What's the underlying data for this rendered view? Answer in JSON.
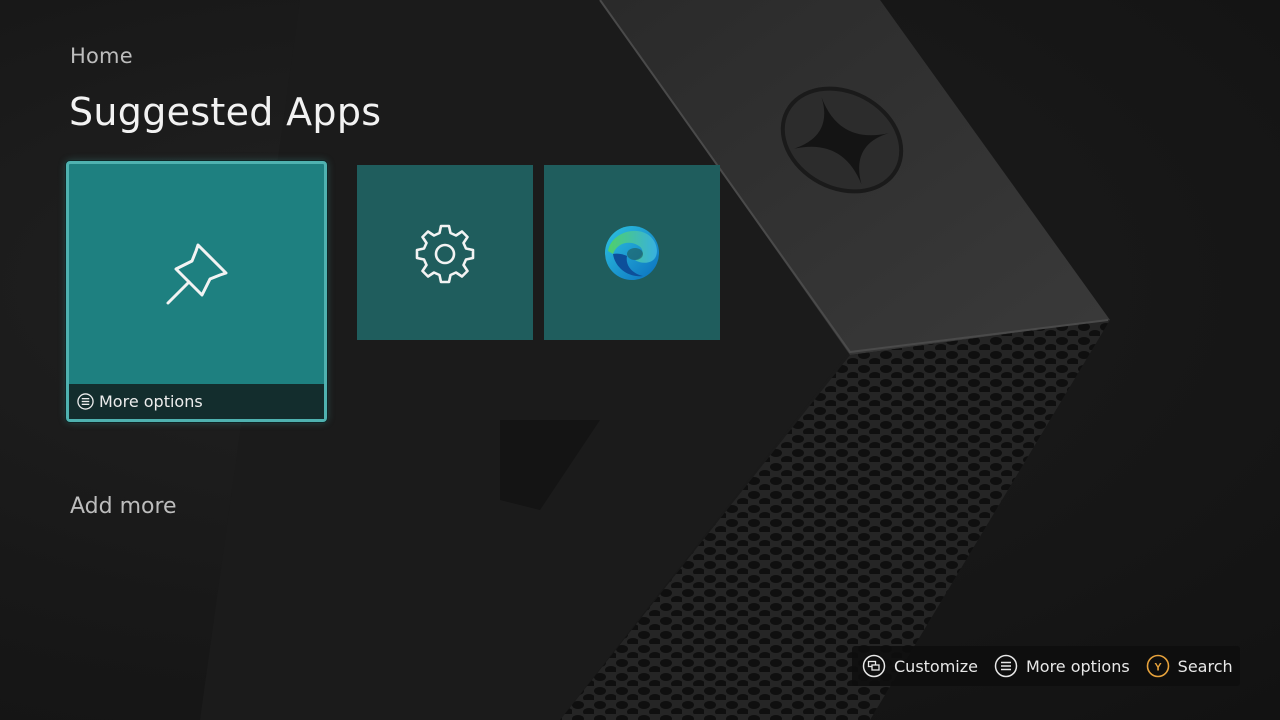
{
  "header": {
    "breadcrumb": "Home",
    "title": "Suggested Apps"
  },
  "tiles": [
    {
      "id": "pin",
      "icon": "pin-icon",
      "footer_label": "More options",
      "focused": true
    },
    {
      "id": "settings",
      "icon": "gear-icon",
      "focused": false
    },
    {
      "id": "edge",
      "icon": "edge-browser-icon",
      "focused": false
    }
  ],
  "add_more": {
    "label": "Add more"
  },
  "hint_bar": {
    "items": [
      {
        "icon": "view-button-icon",
        "label": "Customize"
      },
      {
        "icon": "menu-button-icon",
        "label": "More options"
      },
      {
        "icon": "y-button-icon",
        "label": "Search",
        "badge": "Y"
      }
    ]
  },
  "colors": {
    "tile_teal": "#1f5d5d",
    "tile_focused": "#1e8080",
    "focus_border": "#4fb2b0",
    "y_button": "#e8a33c",
    "background": "#161616"
  }
}
